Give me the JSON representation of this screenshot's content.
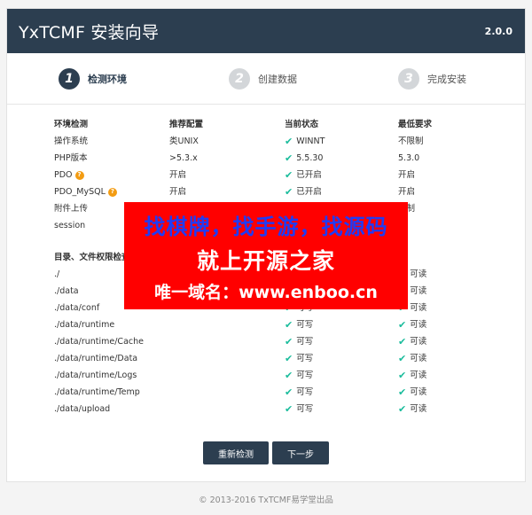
{
  "header": {
    "title": "YxTCMF 安装向导",
    "version": "2.0.0"
  },
  "steps": [
    {
      "num": "1",
      "label": "检测环境",
      "active": true
    },
    {
      "num": "2",
      "label": "创建数据",
      "active": false
    },
    {
      "num": "3",
      "label": "完成安装",
      "active": false
    }
  ],
  "env": {
    "headers": [
      "环境检测",
      "推荐配置",
      "当前状态",
      "最低要求"
    ],
    "rows": [
      {
        "name": "操作系统",
        "help": false,
        "recommended": "类UNIX",
        "current": "WINNT",
        "min": "不限制"
      },
      {
        "name": "PHP版本",
        "help": false,
        "recommended": ">5.3.x",
        "current": "5.5.30",
        "min": "5.3.0"
      },
      {
        "name": "PDO",
        "help": true,
        "recommended": "开启",
        "current": "已开启",
        "min": "开启"
      },
      {
        "name": "PDO_MySQL",
        "help": true,
        "recommended": "开启",
        "current": "已开启",
        "min": "开启"
      },
      {
        "name": "附件上传",
        "help": false,
        "recommended": "",
        "current": "",
        "min": "限制"
      },
      {
        "name": "session",
        "help": false,
        "recommended": "",
        "current": "",
        "min": "启"
      }
    ]
  },
  "perm": {
    "headers": [
      "目录、文件权限检查",
      "",
      "",
      "取"
    ],
    "rows": [
      {
        "path": "./",
        "write": "",
        "read": "可读"
      },
      {
        "path": "./data",
        "write": "",
        "read": "可读"
      },
      {
        "path": "./data/conf",
        "write": "可写",
        "read": "可读"
      },
      {
        "path": "./data/runtime",
        "write": "可写",
        "read": "可读"
      },
      {
        "path": "./data/runtime/Cache",
        "write": "可写",
        "read": "可读"
      },
      {
        "path": "./data/runtime/Data",
        "write": "可写",
        "read": "可读"
      },
      {
        "path": "./data/runtime/Logs",
        "write": "可写",
        "read": "可读"
      },
      {
        "path": "./data/runtime/Temp",
        "write": "可写",
        "read": "可读"
      },
      {
        "path": "./data/upload",
        "write": "可写",
        "read": "可读"
      }
    ]
  },
  "buttons": {
    "recheck": "重新检测",
    "next": "下一步"
  },
  "footer": "© 2013-2016 TxTCMF易学堂出品",
  "ad": {
    "line1": "找棋牌，找手游，找源码",
    "line2": "就上开源之家",
    "line3": "唯一域名：www.enboo.cn"
  },
  "colors": {
    "header": "#2c3e50",
    "check": "#1abc9c",
    "help": "#f39c12",
    "ad_bg": "#ff0000"
  }
}
